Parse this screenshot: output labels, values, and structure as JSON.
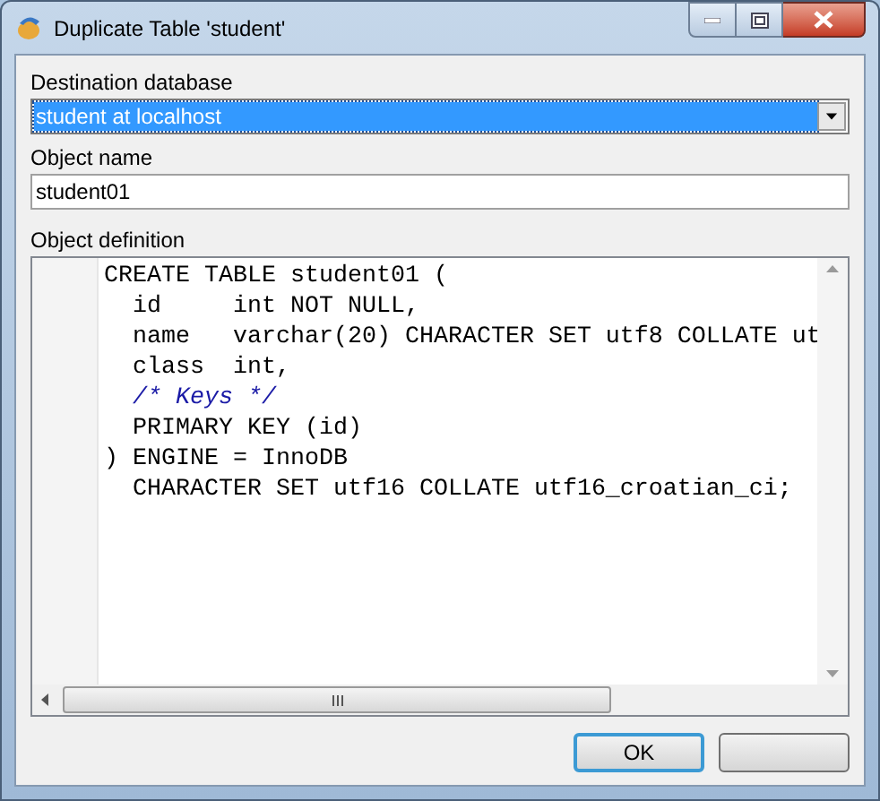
{
  "window": {
    "title": "Duplicate Table 'student'"
  },
  "destination_database": {
    "label": "Destination database",
    "value": "student at localhost",
    "selected": true
  },
  "object_name": {
    "label": "Object name",
    "value": "student01"
  },
  "object_definition": {
    "label": "Object definition",
    "lines": [
      {
        "kind": "code",
        "text": "CREATE TABLE student01 ("
      },
      {
        "kind": "code",
        "text": "  id     int NOT NULL,"
      },
      {
        "kind": "code",
        "text": "  name   varchar(20) CHARACTER SET utf8 COLLATE ut"
      },
      {
        "kind": "code",
        "text": "  class  int,"
      },
      {
        "kind": "comment",
        "text": "  /* Keys */"
      },
      {
        "kind": "code",
        "text": "  PRIMARY KEY (id)"
      },
      {
        "kind": "code",
        "text": ") ENGINE = InnoDB"
      },
      {
        "kind": "code",
        "text": "  CHARACTER SET utf16 COLLATE utf16_croatian_ci;"
      }
    ]
  },
  "buttons": [
    {
      "label": "OK",
      "default": true
    },
    {
      "default": false
    }
  ]
}
